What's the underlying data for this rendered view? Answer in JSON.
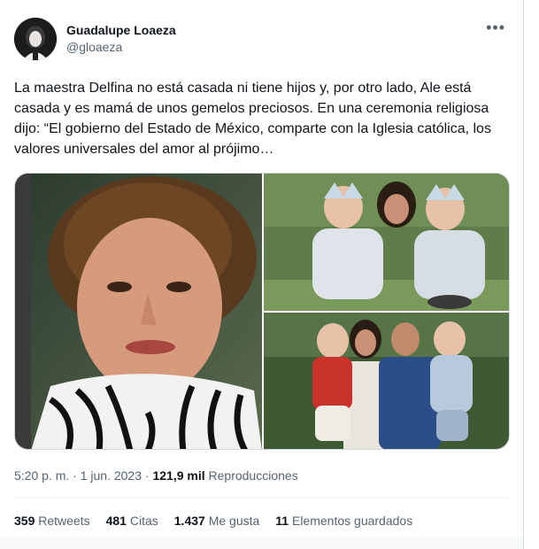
{
  "author": {
    "display_name": "Guadalupe Loaeza",
    "handle": "@gloaeza"
  },
  "tweet": {
    "text": "La maestra Delfina no está casada ni tiene hijos y, por otro lado, Ale está casada y es mamá de unos gemelos preciosos. En una ceremonia religiosa dijo: “El gobierno del Estado de México, comparte con la Iglesia católica, los valores universales del amor al prójimo…",
    "time": "5:20 p. m.",
    "date": "1 jun. 2023",
    "views_count": "121,9 mil",
    "views_label": "Reproducciones",
    "separator": "·"
  },
  "stats": [
    {
      "count": "359",
      "label": "Retweets"
    },
    {
      "count": "481",
      "label": "Citas"
    },
    {
      "count": "1.437",
      "label": "Me gusta"
    },
    {
      "count": "11",
      "label": "Elementos guardados"
    }
  ],
  "icons": {
    "more": "more-options-icon"
  },
  "colors": {
    "text_primary": "#0f1419",
    "text_secondary": "#536471",
    "border": "#cfd9de"
  }
}
